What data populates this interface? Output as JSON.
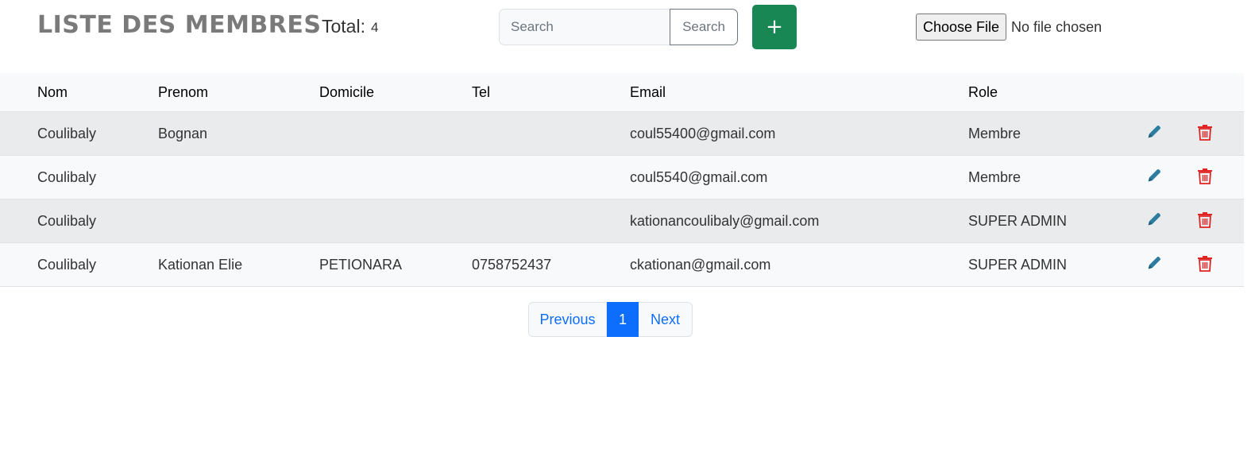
{
  "header": {
    "title": "LISTE DES MEMBRES",
    "total_label": "Total:",
    "total_value": "4",
    "search_placeholder": "Search",
    "search_button": "Search",
    "add_button": "+",
    "choose_file_button": "Choose File",
    "file_status": "No file chosen"
  },
  "table": {
    "columns": [
      "Nom",
      "Prenom",
      "Domicile",
      "Tel",
      "Email",
      "Role"
    ],
    "rows": [
      {
        "nom": "Coulibaly",
        "prenom": "Bognan",
        "domicile": "",
        "tel": "",
        "email": "coul55400@gmail.com",
        "role": "Membre"
      },
      {
        "nom": "Coulibaly",
        "prenom": "",
        "domicile": "",
        "tel": "",
        "email": "coul5540@gmail.com",
        "role": "Membre"
      },
      {
        "nom": "Coulibaly",
        "prenom": "",
        "domicile": "",
        "tel": "",
        "email": "kationancoulibaly@gmail.com",
        "role": "SUPER ADMIN"
      },
      {
        "nom": "Coulibaly",
        "prenom": "Kationan Elie",
        "domicile": "PETIONARA",
        "tel": "0758752437",
        "email": "ckationan@gmail.com",
        "role": "SUPER ADMIN"
      }
    ],
    "row_actions": {
      "edit_icon": "pencil-icon",
      "delete_icon": "trash-icon"
    }
  },
  "pagination": {
    "previous": "Previous",
    "current": "1",
    "next": "Next"
  },
  "colors": {
    "title_gray": "#7a7a7a",
    "add_button_green": "#198754",
    "primary_blue": "#0d6efd",
    "edit_icon_teal": "#2c7da0",
    "delete_icon_red": "#e02424",
    "striped_row": "#eaebec",
    "light_row": "#f8f9fa"
  }
}
